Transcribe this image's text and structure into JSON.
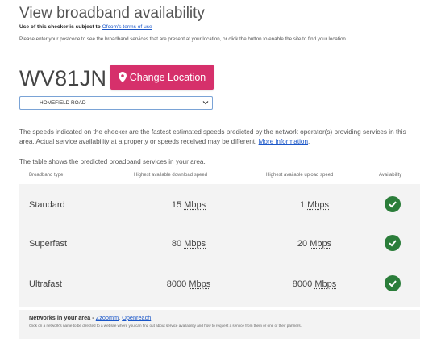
{
  "page": {
    "title": "View broadband availability",
    "terms_prefix": "Use of this checker is subject to",
    "terms_link": "Ofcom's terms of use",
    "instructions": "Please enter your postcode to see the broadband services that are present at your location, or click the button to enable the site to find your location"
  },
  "location": {
    "postcode": "WV81JN",
    "change_button": "Change Location",
    "address_selected": "HOMEFIELD ROAD"
  },
  "notes": {
    "speeds": "The speeds indicated on the checker are the fastest estimated speeds predicted by the network operator(s) providing services in this area. Actual service availability at a property or speeds received may be different.",
    "more_info_link": "More information",
    "table_intro": "The table shows the predicted broadband services in your area."
  },
  "table": {
    "headers": [
      "Broadband type",
      "Highest available download speed",
      "Highest available upload speed",
      "Availability"
    ],
    "rows": [
      {
        "type": "Standard",
        "download": "15",
        "download_unit": "Mbps",
        "upload": "1",
        "upload_unit": "Mbps",
        "available": true
      },
      {
        "type": "Superfast",
        "download": "80",
        "download_unit": "Mbps",
        "upload": "20",
        "upload_unit": "Mbps",
        "available": true
      },
      {
        "type": "Ultrafast",
        "download": "8000",
        "download_unit": "Mbps",
        "upload": "8000",
        "upload_unit": "Mbps",
        "available": true
      }
    ]
  },
  "networks": {
    "label": "Networks in your area - ",
    "links": [
      "Zzoomm",
      "Openreach"
    ],
    "description": "Click on a network's name to be directed to a website where you can find out about service availability and how to request a service from them or one of their partners."
  },
  "colors": {
    "button": "#d6306b",
    "check": "#2b7d3a",
    "link": "#1a56c8"
  }
}
